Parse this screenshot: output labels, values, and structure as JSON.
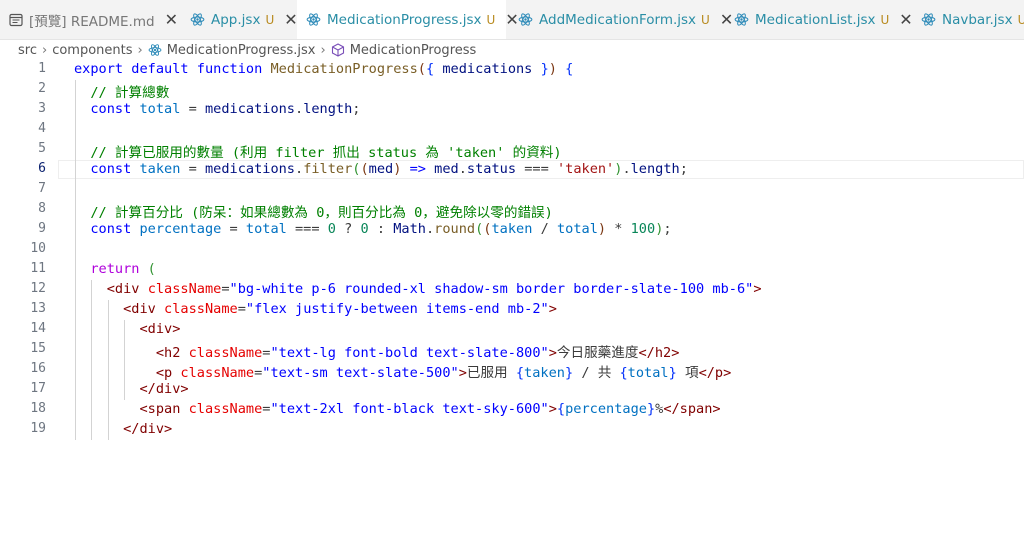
{
  "tabs": [
    {
      "label": "[預覽] README.md",
      "modified": "",
      "active": false,
      "preview": true,
      "icon": "preview-icon"
    },
    {
      "label": "App.jsx",
      "modified": "U",
      "active": false,
      "preview": false,
      "icon": "react-icon"
    },
    {
      "label": "MedicationProgress.jsx",
      "modified": "U",
      "active": true,
      "preview": false,
      "icon": "react-icon"
    },
    {
      "label": "AddMedicationForm.jsx",
      "modified": "U",
      "active": false,
      "preview": false,
      "icon": "react-icon"
    },
    {
      "label": "MedicationList.jsx",
      "modified": "U",
      "active": false,
      "preview": false,
      "icon": "react-icon"
    },
    {
      "label": "Navbar.jsx",
      "modified": "U",
      "active": false,
      "preview": false,
      "icon": "react-icon"
    }
  ],
  "breadcrumb": {
    "folder1": "src",
    "folder2": "components",
    "file": "MedicationProgress.jsx",
    "symbol": "MedicationProgress"
  },
  "editor": {
    "current_line": 6,
    "lines": [
      {
        "n": "1",
        "t": [
          [
            "kw",
            "export"
          ],
          [
            "pl",
            " "
          ],
          [
            "kw",
            "default"
          ],
          [
            "pl",
            " "
          ],
          [
            "kw",
            "function"
          ],
          [
            "pl",
            " "
          ],
          [
            "fn",
            "MedicationProgress"
          ],
          [
            "br3",
            "("
          ],
          [
            "bk",
            "{"
          ],
          [
            "pl",
            " "
          ],
          [
            "prm",
            "medications"
          ],
          [
            "pl",
            " "
          ],
          [
            "bk",
            "}"
          ],
          [
            "br3",
            ")"
          ],
          [
            "pl",
            " "
          ],
          [
            "bk",
            "{"
          ]
        ]
      },
      {
        "n": "2",
        "t": [
          [
            "cmt",
            "  // 計算總數"
          ]
        ]
      },
      {
        "n": "3",
        "t": [
          [
            "pl",
            "  "
          ],
          [
            "kw",
            "const"
          ],
          [
            "pl",
            " "
          ],
          [
            "var",
            "total"
          ],
          [
            "pl",
            " = "
          ],
          [
            "prm",
            "medications"
          ],
          [
            "pl",
            "."
          ],
          [
            "prm",
            "length"
          ],
          [
            "pl",
            ";"
          ]
        ]
      },
      {
        "n": "4",
        "t": []
      },
      {
        "n": "5",
        "t": [
          [
            "cmt",
            "  // 計算已服用的數量 (利用 filter 抓出 status 為 'taken' 的資料)"
          ]
        ]
      },
      {
        "n": "6",
        "t": [
          [
            "pl",
            "  "
          ],
          [
            "kw",
            "const"
          ],
          [
            "pl",
            " "
          ],
          [
            "var",
            "taken"
          ],
          [
            "pl",
            " = "
          ],
          [
            "prm",
            "medications"
          ],
          [
            "pl",
            "."
          ],
          [
            "fn",
            "filter"
          ],
          [
            "br2",
            "("
          ],
          [
            "br3",
            "("
          ],
          [
            "prm",
            "med"
          ],
          [
            "br3",
            ")"
          ],
          [
            "pl",
            " "
          ],
          [
            "kw",
            "=>"
          ],
          [
            "pl",
            " "
          ],
          [
            "prm",
            "med"
          ],
          [
            "pl",
            "."
          ],
          [
            "prm",
            "status"
          ],
          [
            "pl",
            " === "
          ],
          [
            "str",
            "'taken'"
          ],
          [
            "br2",
            ")"
          ],
          [
            "pl",
            "."
          ],
          [
            "prm",
            "length"
          ],
          [
            "pl",
            ";"
          ]
        ]
      },
      {
        "n": "7",
        "t": []
      },
      {
        "n": "8",
        "t": [
          [
            "cmt",
            "  // 計算百分比 (防呆：如果總數為 0，則百分比為 0，避免除以零的錯誤)"
          ]
        ]
      },
      {
        "n": "9",
        "t": [
          [
            "pl",
            "  "
          ],
          [
            "kw",
            "const"
          ],
          [
            "pl",
            " "
          ],
          [
            "var",
            "percentage"
          ],
          [
            "pl",
            " = "
          ],
          [
            "var",
            "total"
          ],
          [
            "pl",
            " === "
          ],
          [
            "num",
            "0"
          ],
          [
            "pl",
            " ? "
          ],
          [
            "num",
            "0"
          ],
          [
            "pl",
            " : "
          ],
          [
            "prm",
            "Math"
          ],
          [
            "pl",
            "."
          ],
          [
            "fn",
            "round"
          ],
          [
            "br2",
            "("
          ],
          [
            "br3",
            "("
          ],
          [
            "var",
            "taken"
          ],
          [
            "pl",
            " / "
          ],
          [
            "var",
            "total"
          ],
          [
            "br3",
            ")"
          ],
          [
            "pl",
            " * "
          ],
          [
            "num",
            "100"
          ],
          [
            "br2",
            ")"
          ],
          [
            "pl",
            ";"
          ]
        ]
      },
      {
        "n": "10",
        "t": []
      },
      {
        "n": "11",
        "t": [
          [
            "pl",
            "  "
          ],
          [
            "ctl",
            "return"
          ],
          [
            "pl",
            " "
          ],
          [
            "br2",
            "("
          ]
        ]
      },
      {
        "n": "12",
        "t": [
          [
            "pl",
            "    "
          ],
          [
            "tag",
            "<div"
          ],
          [
            "pl",
            " "
          ],
          [
            "att",
            "className"
          ],
          [
            "pl",
            "="
          ],
          [
            "jstr",
            "\"bg-white p-6 rounded-xl shadow-sm border border-slate-100 mb-6\""
          ],
          [
            "tag",
            ">"
          ]
        ]
      },
      {
        "n": "13",
        "t": [
          [
            "pl",
            "      "
          ],
          [
            "tag",
            "<div"
          ],
          [
            "pl",
            " "
          ],
          [
            "att",
            "className"
          ],
          [
            "pl",
            "="
          ],
          [
            "jstr",
            "\"flex justify-between items-end mb-2\""
          ],
          [
            "tag",
            ">"
          ]
        ]
      },
      {
        "n": "14",
        "t": [
          [
            "pl",
            "        "
          ],
          [
            "tag",
            "<div>"
          ]
        ]
      },
      {
        "n": "15",
        "t": [
          [
            "pl",
            "          "
          ],
          [
            "tag",
            "<h2"
          ],
          [
            "pl",
            " "
          ],
          [
            "att",
            "className"
          ],
          [
            "pl",
            "="
          ],
          [
            "jstr",
            "\"text-lg font-bold text-slate-800\""
          ],
          [
            "tag",
            ">"
          ],
          [
            "pl",
            "今日服藥進度"
          ],
          [
            "tag",
            "</h2>"
          ]
        ]
      },
      {
        "n": "16",
        "t": [
          [
            "pl",
            "          "
          ],
          [
            "tag",
            "<p"
          ],
          [
            "pl",
            " "
          ],
          [
            "att",
            "className"
          ],
          [
            "pl",
            "="
          ],
          [
            "jstr",
            "\"text-sm text-slate-500\""
          ],
          [
            "tag",
            ">"
          ],
          [
            "pl",
            "已服用 "
          ],
          [
            "bk",
            "{"
          ],
          [
            "var",
            "taken"
          ],
          [
            "bk",
            "}"
          ],
          [
            "pl",
            " / 共 "
          ],
          [
            "bk",
            "{"
          ],
          [
            "var",
            "total"
          ],
          [
            "bk",
            "}"
          ],
          [
            "pl",
            " 項"
          ],
          [
            "tag",
            "</p>"
          ]
        ]
      },
      {
        "n": "17",
        "t": [
          [
            "pl",
            "        "
          ],
          [
            "tag",
            "</div>"
          ]
        ]
      },
      {
        "n": "18",
        "t": [
          [
            "pl",
            "        "
          ],
          [
            "tag",
            "<span"
          ],
          [
            "pl",
            " "
          ],
          [
            "att",
            "className"
          ],
          [
            "pl",
            "="
          ],
          [
            "jstr",
            "\"text-2xl font-black text-sky-600\""
          ],
          [
            "tag",
            ">"
          ],
          [
            "bk",
            "{"
          ],
          [
            "var",
            "percentage"
          ],
          [
            "bk",
            "}"
          ],
          [
            "pl",
            "%"
          ],
          [
            "tag",
            "</span>"
          ]
        ]
      },
      {
        "n": "19",
        "t": [
          [
            "pl",
            "      "
          ],
          [
            "tag",
            "</div>"
          ]
        ]
      }
    ]
  }
}
